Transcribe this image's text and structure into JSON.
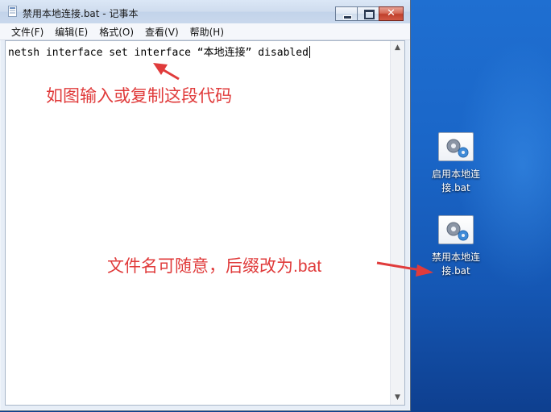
{
  "window": {
    "title": "禁用本地连接.bat - 记事本",
    "menu": [
      "文件(F)",
      "编辑(E)",
      "格式(O)",
      "查看(V)",
      "帮助(H)"
    ]
  },
  "editor": {
    "content": "netsh interface set interface “本地连接” disabled"
  },
  "annotations": {
    "top": "如图输入或复制这段代码",
    "bottom_prefix": "文件名可随意，后缀改为",
    "bottom_ext": ".bat"
  },
  "desktop_icons": [
    {
      "line1": "启用本地连",
      "line2": "接.bat",
      "icon": "gear-batch-file-icon"
    },
    {
      "line1": "禁用本地连",
      "line2": "接.bat",
      "icon": "gear-batch-file-icon"
    }
  ],
  "colors": {
    "annotation": "#e03b3b",
    "desktop": "#1a66c8"
  }
}
